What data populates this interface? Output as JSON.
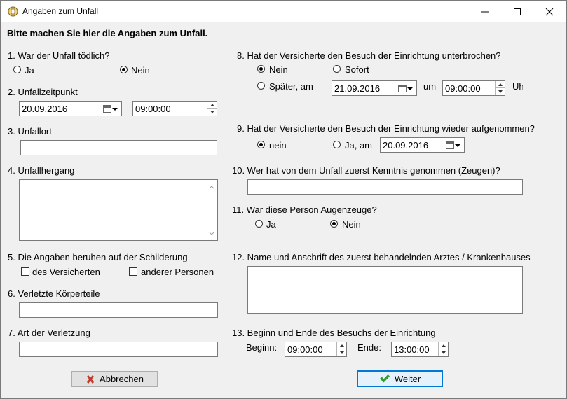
{
  "window": {
    "title": "Angaben zum Unfall"
  },
  "intro": "Bitte machen Sie hier die Angaben zum Unfall.",
  "q1": {
    "label": "1. War der Unfall tödlich?",
    "opt_yes": "Ja",
    "opt_no": "Nein",
    "selected": "Nein"
  },
  "q2": {
    "label": "2. Unfallzeitpunkt",
    "date": "20.09.2016",
    "time": "09:00:00"
  },
  "q3": {
    "label": "3. Unfallort",
    "value": ""
  },
  "q4": {
    "label": "4. Unfallhergang",
    "value": ""
  },
  "q5": {
    "label": "5. Die Angaben beruhen auf der Schilderung",
    "opt_insured": "des Versicherten",
    "opt_others": "anderer Personen"
  },
  "q6": {
    "label": "6. Verletzte Körperteile",
    "value": ""
  },
  "q7": {
    "label": "7. Art der Verletzung",
    "value": ""
  },
  "q8": {
    "label": "8. Hat der Versicherte den Besuch der  Einrichtung unterbrochen?",
    "opt_no": "Nein",
    "opt_immediately": "Sofort",
    "opt_later": "Später, am",
    "date": "21.09.2016",
    "um": "um",
    "time": "09:00:00",
    "uhr": "Uhr",
    "selected": "Nein"
  },
  "q9": {
    "label": "9. Hat der Versicherte den Besuch der  Einrichtung wieder aufgenommen?",
    "opt_no": "nein",
    "opt_yes": "Ja, am",
    "date": "20.09.2016",
    "selected": "nein"
  },
  "q10": {
    "label": "10. Wer hat von dem Unfall zuerst Kenntnis genommen (Zeugen)?",
    "value": ""
  },
  "q11": {
    "label": "11. War diese Person Augenzeuge?",
    "opt_yes": "Ja",
    "opt_no": "Nein",
    "selected": "Nein"
  },
  "q12": {
    "label": "12. Name und Anschrift des zuerst behandelnden Arztes / Krankenhauses",
    "value": ""
  },
  "q13": {
    "label": "13. Beginn und Ende des Besuchs der Einrichtung",
    "begin_label": "Beginn:",
    "begin": "09:00:00",
    "end_label": "Ende:",
    "end": "13:00:00"
  },
  "buttons": {
    "cancel": "Abbrechen",
    "next": "Weiter"
  },
  "colors": {
    "cancel_icon": "#c0392b",
    "next_icon": "#2e9e2e",
    "default_button_border": "#0078d7"
  }
}
